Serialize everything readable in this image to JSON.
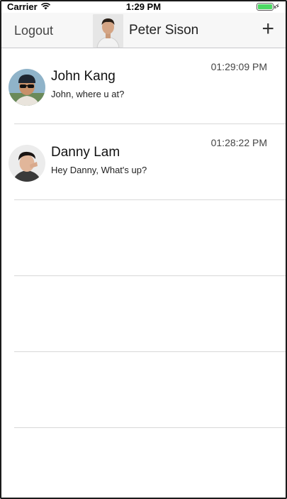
{
  "status_bar": {
    "carrier": "Carrier",
    "time": "1:29 PM",
    "wifi_icon": "wifi-icon",
    "battery_icon": "battery-icon",
    "battery_level": 1.0,
    "charging_icon": "bolt-icon"
  },
  "nav": {
    "logout_label": "Logout",
    "title": "Peter Sison",
    "avatar_icon": "profile-photo",
    "add_icon": "plus-icon",
    "add_label": "+"
  },
  "chats": [
    {
      "name": "John Kang",
      "message": "John, where u at?",
      "time": "01:29:09 PM",
      "avatar": "john-kang-photo"
    },
    {
      "name": "Danny Lam",
      "message": "Hey Danny, What's up?",
      "time": "01:28:22 PM",
      "avatar": "danny-lam-photo"
    }
  ],
  "colors": {
    "battery": "#4cd964",
    "nav_background": "#f7f7f7",
    "separator": "#d8d8d8"
  }
}
